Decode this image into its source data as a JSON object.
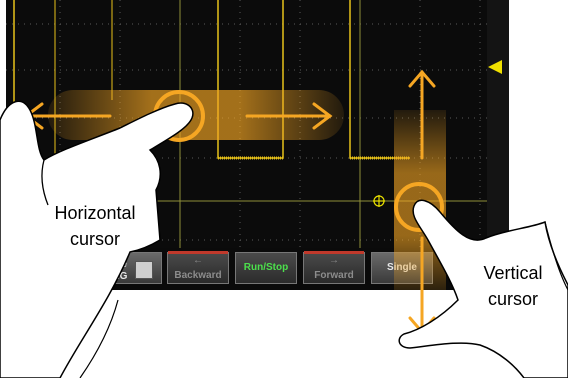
{
  "softkeys": {
    "save_label": "Save\n.PNG",
    "backward_label": "Backward",
    "runstop_label": "Run/Stop",
    "forward_label": "Forward",
    "single_label": "Single"
  },
  "callouts": {
    "horizontal": "Horizontal\ncursor",
    "vertical": "Vertical\ncursor"
  },
  "colors": {
    "trace": "#e8c21a",
    "grid": "#6a6a30",
    "gesture": "#f5a623",
    "run_text": "#4ce04c"
  },
  "icons": {
    "trigger_marker": "triangle-left-icon",
    "cursor_marker": "crosshair-icon",
    "save_icon": "floppy-icon"
  }
}
